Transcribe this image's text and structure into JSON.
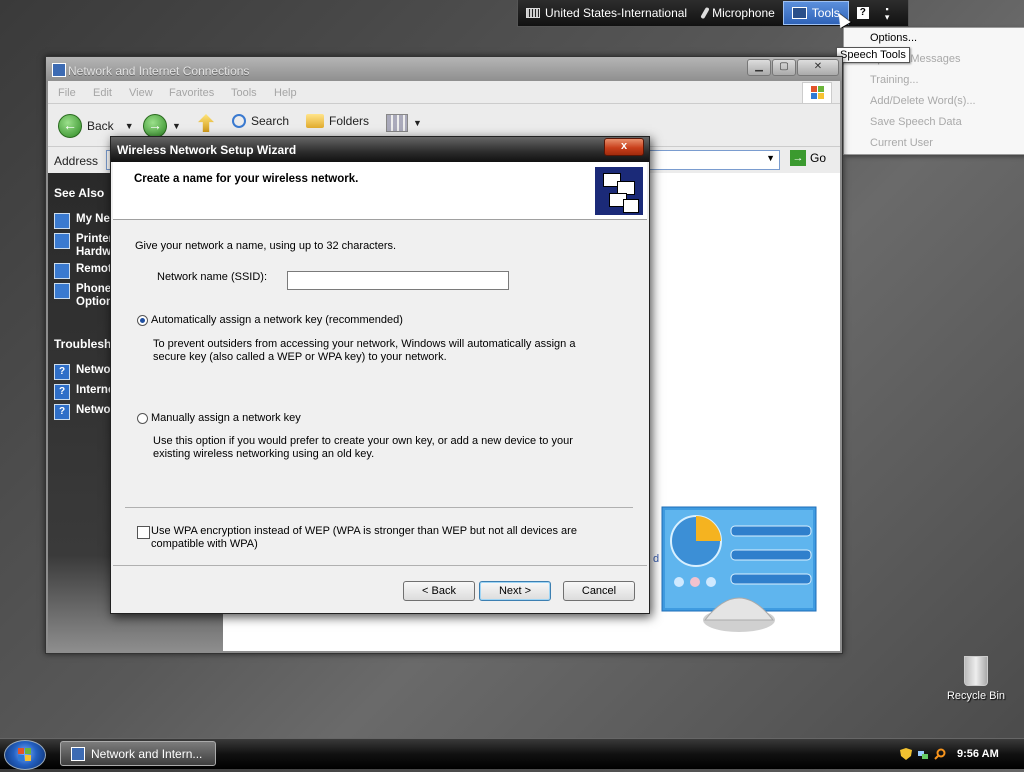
{
  "langbar": {
    "language": "United States-International",
    "microphone": "Microphone",
    "tools": "Tools",
    "help": "?"
  },
  "tools_menu": {
    "items": [
      "Options...",
      "Speech Messages",
      "Training...",
      "Add/Delete Word(s)...",
      "Save Speech Data",
      "Current User"
    ],
    "tooltip": "Speech Tools"
  },
  "explorer": {
    "title": "Network and Internet Connections",
    "menu": [
      "File",
      "Edit",
      "View",
      "Favorites",
      "Tools",
      "Help"
    ],
    "toolbar": {
      "back": "Back",
      "search": "Search",
      "folders": "Folders"
    },
    "address_label": "Address",
    "go": "Go",
    "left_pane": {
      "see_also": "See Also",
      "see_also_links": [
        "My Net",
        "Printer Hardw",
        "Remote",
        "Phone Option"
      ],
      "troubleshoot": "Troublesho",
      "troubleshoot_links": [
        "Netwo",
        "Interne",
        "Netwo"
      ]
    },
    "content_fragment": "d"
  },
  "wizard": {
    "title": "Wireless Network Setup Wizard",
    "close": "x",
    "header": "Create a name for your wireless network.",
    "intro": "Give your network a name, using up to 32 characters.",
    "ssid_label": "Network name (SSID):",
    "ssid_value": "",
    "auto_option": "Automatically assign a network key (recommended)",
    "auto_desc": "To prevent outsiders from accessing your network, Windows will automatically assign a secure key (also called a WEP or WPA key) to your network.",
    "manual_option": "Manually assign a network key",
    "manual_desc": "Use this option if you would prefer to create your own key, or add a new device to your existing wireless networking using an old key.",
    "wpa_option": "Use WPA encryption instead of WEP (WPA is stronger than WEP but not all devices are compatible with WPA)",
    "selected": "auto",
    "wpa_checked": false,
    "buttons": {
      "back": "< Back",
      "next": "Next >",
      "cancel": "Cancel"
    }
  },
  "desktop": {
    "recycle_bin": "Recycle Bin"
  },
  "taskbar": {
    "task": "Network and Intern...",
    "time": "9:56 AM"
  }
}
